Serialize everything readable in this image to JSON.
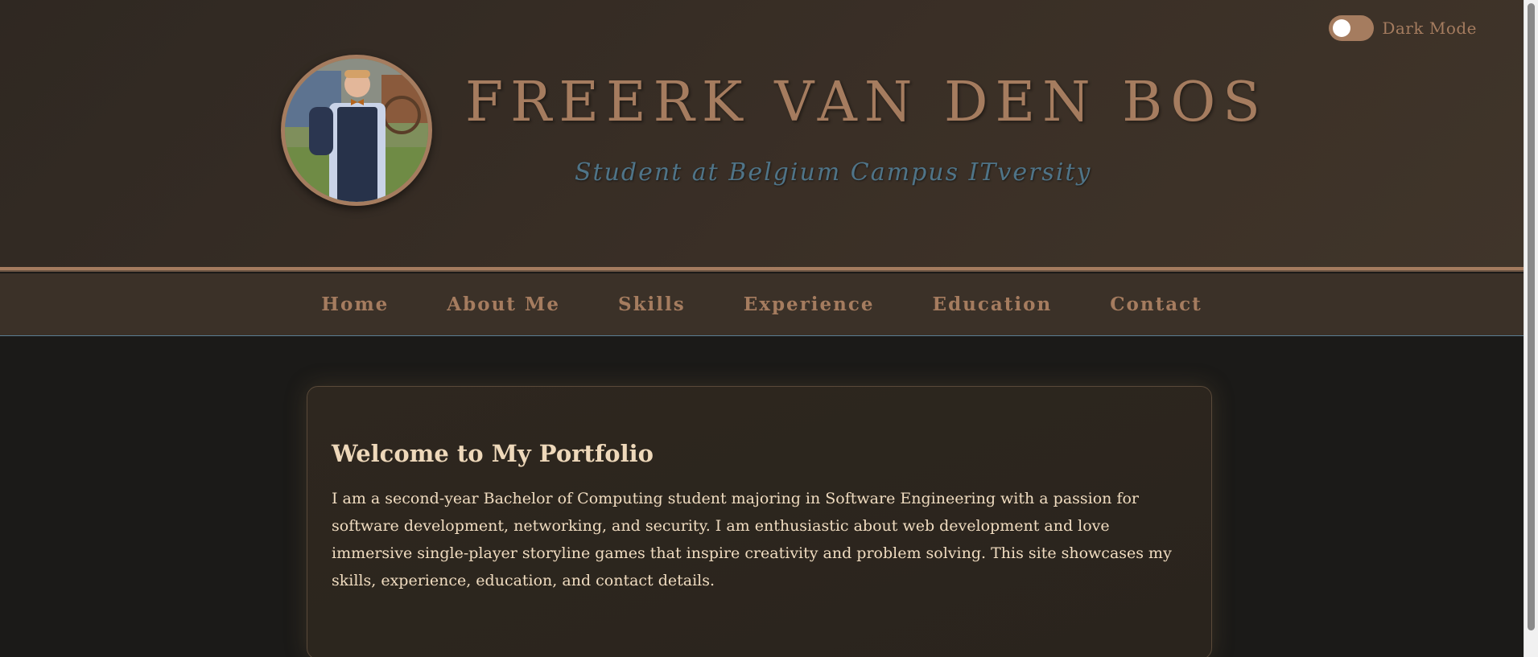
{
  "header": {
    "title": "Freerk van den Bos",
    "subtitle": "Student at Belgium Campus ITversity",
    "dark_mode_label": "Dark Mode",
    "dark_mode_on": false,
    "accent_color": "#a57c5f",
    "subtitle_color": "#4f7488"
  },
  "nav": {
    "items": [
      {
        "label": "Home"
      },
      {
        "label": "About Me"
      },
      {
        "label": "Skills"
      },
      {
        "label": "Experience"
      },
      {
        "label": "Education"
      },
      {
        "label": "Contact"
      }
    ]
  },
  "main": {
    "heading": "Welcome to My Portfolio",
    "body": "I am a second-year Bachelor of Computing student majoring in Software Engineering with a passion for software development, networking, and security. I am enthusiastic about web development and love immersive single-player storyline games that inspire creativity and problem solving. This site showcases my skills, experience, education, and contact details."
  }
}
